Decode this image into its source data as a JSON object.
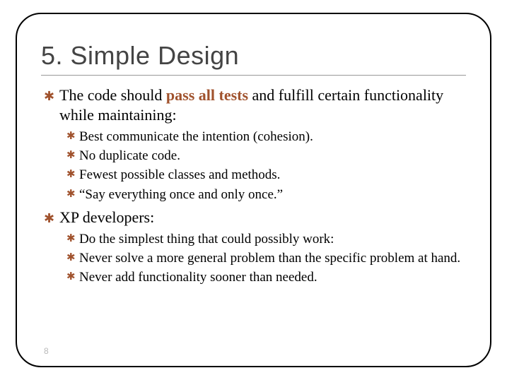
{
  "title": "5. Simple Design",
  "bullet_glyph": "✱",
  "accent_color": "#a0522d",
  "page_number": "8",
  "items": [
    {
      "pre": "The code should ",
      "emph": "pass all tests",
      "post": " and fulfill certain functionality while maintaining:",
      "sub": [
        "Best communicate the intention (cohesion).",
        "No duplicate code.",
        "Fewest possible classes and methods.",
        "“Say everything once and only once.”"
      ]
    },
    {
      "pre": "XP developers:",
      "emph": "",
      "post": "",
      "sub": [
        "Do the simplest thing that could possibly work:",
        "Never solve a more general problem than the specific problem at hand.",
        "Never add functionality sooner than needed."
      ]
    }
  ]
}
